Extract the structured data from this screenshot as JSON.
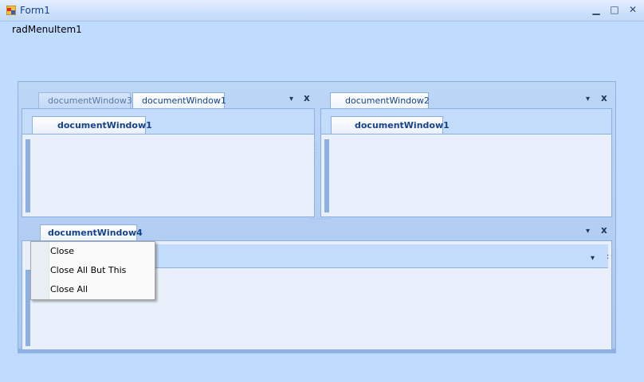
{
  "window": {
    "title": "Form1",
    "minimize_glyph": "▁",
    "maximize_glyph": "□",
    "close_glyph": "✕",
    "icon": "form-app-icon"
  },
  "menu": {
    "item": "radMenuItem1"
  },
  "top_left_pane": {
    "tabs": [
      "documentWindow3",
      "documentWindow1"
    ],
    "active_tab": "documentWindow1",
    "inner_tab": "documentWindow1",
    "dropdown_glyph": "▾",
    "close_glyph": "x"
  },
  "top_right_pane": {
    "tabs": [
      "documentWindow2"
    ],
    "active_tab": "documentWindow2",
    "inner_tab": "documentWindow1",
    "dropdown_glyph": "▾",
    "close_glyph": "x"
  },
  "bottom_pane": {
    "tabs": [
      "documentWindow4"
    ],
    "active_tab": "documentWindow4",
    "dropdown_glyph": "▾",
    "close_glyph": "x",
    "inner_dropdown_glyph": "▾",
    "inner_extra_glyph": ":"
  },
  "context_menu": {
    "items": [
      "Close",
      "Close All But This",
      "Close All"
    ]
  },
  "colors": {
    "background": "#bfdbff",
    "accent": "#15428b",
    "border": "#8eb0e0"
  }
}
